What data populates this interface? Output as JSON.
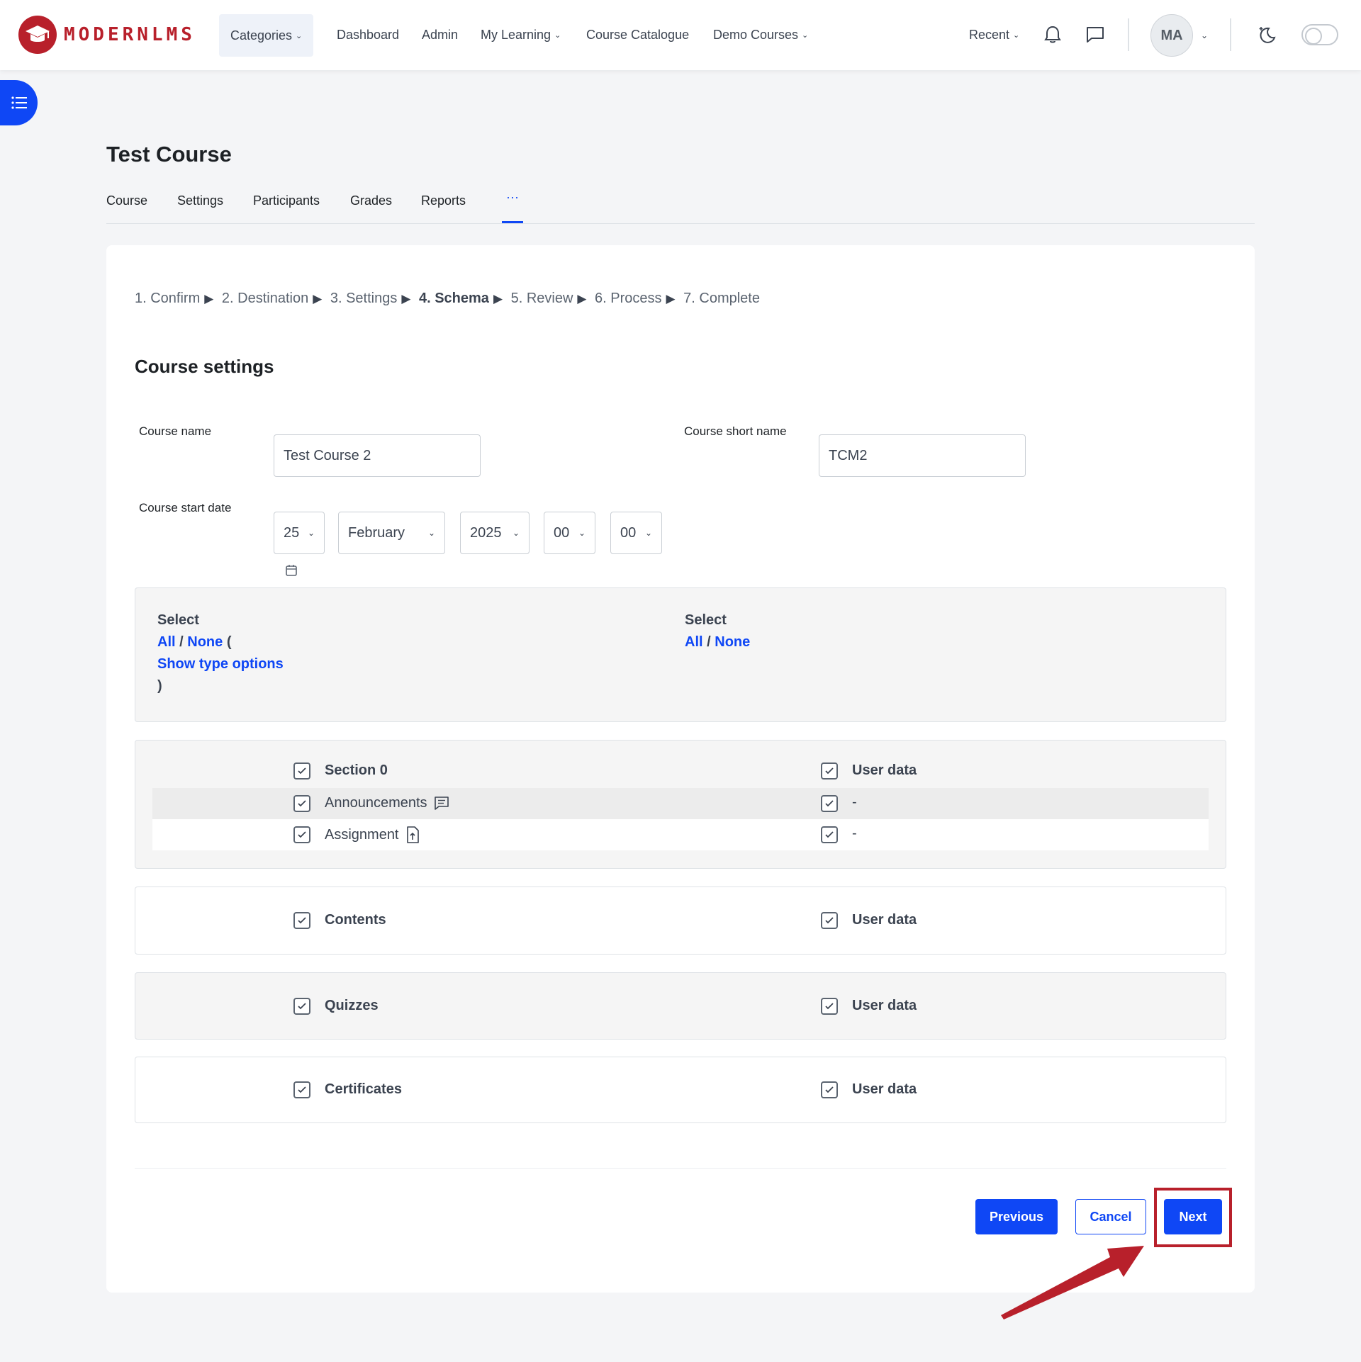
{
  "brand": {
    "name": "MODERNLMS"
  },
  "nav": {
    "items": [
      {
        "label": "Categories",
        "has_dropdown": true
      },
      {
        "label": "Dashboard"
      },
      {
        "label": "Admin"
      },
      {
        "label": "My Learning",
        "has_dropdown": true
      },
      {
        "label": "Course Catalogue"
      },
      {
        "label": "Demo Courses",
        "has_dropdown": true
      }
    ],
    "recent": "Recent",
    "avatar_initials": "MA"
  },
  "page": {
    "title": "Test Course",
    "tabs": [
      "Course",
      "Settings",
      "Participants",
      "Grades",
      "Reports"
    ],
    "tab_more": "···"
  },
  "steps": [
    {
      "label": "1. Confirm",
      "current": false
    },
    {
      "label": "2. Destination",
      "current": false
    },
    {
      "label": "3. Settings",
      "current": false
    },
    {
      "label": "4. Schema",
      "current": true
    },
    {
      "label": "5. Review",
      "current": false
    },
    {
      "label": "6. Process",
      "current": false
    },
    {
      "label": "7. Complete",
      "current": false
    }
  ],
  "form": {
    "heading": "Course settings",
    "course_name_label": "Course name",
    "course_name_value": "Test Course 2",
    "short_name_label": "Course short name",
    "short_name_value": "TCM2",
    "start_date_label": "Course start date",
    "start_day": "25",
    "start_month": "February",
    "start_year": "2025",
    "start_hour": "00",
    "start_minute": "00"
  },
  "select_box": {
    "left": {
      "heading": "Select",
      "all": "All",
      "slash": "/",
      "none": "None",
      "open_paren": "(",
      "show_type": "Show type options",
      "close_paren": ")"
    },
    "right": {
      "heading": "Select",
      "all": "All",
      "slash": "/",
      "none": "None"
    }
  },
  "sections": [
    {
      "title": "Section 0",
      "userdata": "User data",
      "items": [
        {
          "label": "Announcements",
          "icon": "forum-icon",
          "userdata": "-"
        },
        {
          "label": "Assignment",
          "icon": "assignment-icon",
          "userdata": "-"
        }
      ]
    },
    {
      "title": "Contents",
      "userdata": "User data"
    },
    {
      "title": "Quizzes",
      "userdata": "User data"
    },
    {
      "title": "Certificates",
      "userdata": "User data"
    }
  ],
  "buttons": {
    "previous": "Previous",
    "cancel": "Cancel",
    "next": "Next"
  },
  "colors": {
    "primary": "#0f47f5",
    "brand": "#b8202b",
    "annotation": "#b8202b"
  }
}
